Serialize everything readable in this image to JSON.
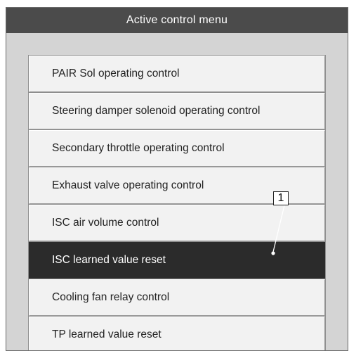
{
  "window": {
    "title": "Active control menu"
  },
  "menu": {
    "items": [
      {
        "label": "PAIR Sol operating control"
      },
      {
        "label": "Steering damper solenoid operating control"
      },
      {
        "label": "Secondary throttle operating control"
      },
      {
        "label": "Exhaust valve operating control"
      },
      {
        "label": "ISC air volume control"
      },
      {
        "label": "ISC learned value reset"
      },
      {
        "label": "Cooling fan relay control"
      },
      {
        "label": "TP learned value reset"
      }
    ],
    "selected_index": 5
  },
  "callout": {
    "number": "1"
  },
  "colors": {
    "titlebar": "#4b4b4b",
    "window_bg": "#d4d4d4",
    "button_bg": "#f2f2f2",
    "selected_bg": "#2b2b2b"
  }
}
